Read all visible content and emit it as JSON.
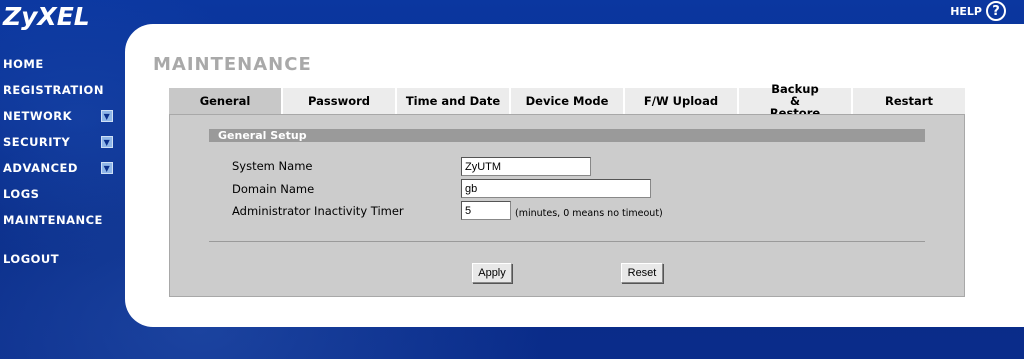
{
  "brand": {
    "logo": "ZyXEL"
  },
  "help": {
    "label": "HELP",
    "icon": "question-circle-icon",
    "glyph": "?"
  },
  "nav": {
    "items": [
      {
        "label": "HOME",
        "expandable": false
      },
      {
        "label": "REGISTRATION",
        "expandable": false
      },
      {
        "label": "NETWORK",
        "expandable": true
      },
      {
        "label": "SECURITY",
        "expandable": true
      },
      {
        "label": "ADVANCED",
        "expandable": true
      },
      {
        "label": "LOGS",
        "expandable": false
      },
      {
        "label": "MAINTENANCE",
        "expandable": false
      },
      {
        "label": "LOGOUT",
        "expandable": false
      }
    ]
  },
  "page": {
    "title": "MAINTENANCE"
  },
  "tabs": [
    {
      "label": "General",
      "active": true
    },
    {
      "label": "Password",
      "active": false
    },
    {
      "label": "Time and Date",
      "active": false
    },
    {
      "label": "Device Mode",
      "active": false
    },
    {
      "label": "F/W Upload",
      "active": false
    },
    {
      "label": "Backup & Restore",
      "active": false
    },
    {
      "label": "Restart",
      "active": false
    }
  ],
  "general_setup": {
    "header": "General Setup",
    "system_name": {
      "label": "System Name",
      "value": "ZyUTM"
    },
    "domain_name": {
      "label": "Domain Name",
      "value": "gb"
    },
    "inactivity_timer": {
      "label": "Administrator Inactivity Timer",
      "value": "5",
      "hint": "(minutes, 0 means no timeout)"
    }
  },
  "buttons": {
    "apply": "Apply",
    "reset": "Reset"
  },
  "colors": {
    "background": "#0a2f8c",
    "panel": "#ffffff",
    "content": "#cccccc",
    "section_header": "#9a9a9a",
    "title": "#a9a9a9"
  }
}
